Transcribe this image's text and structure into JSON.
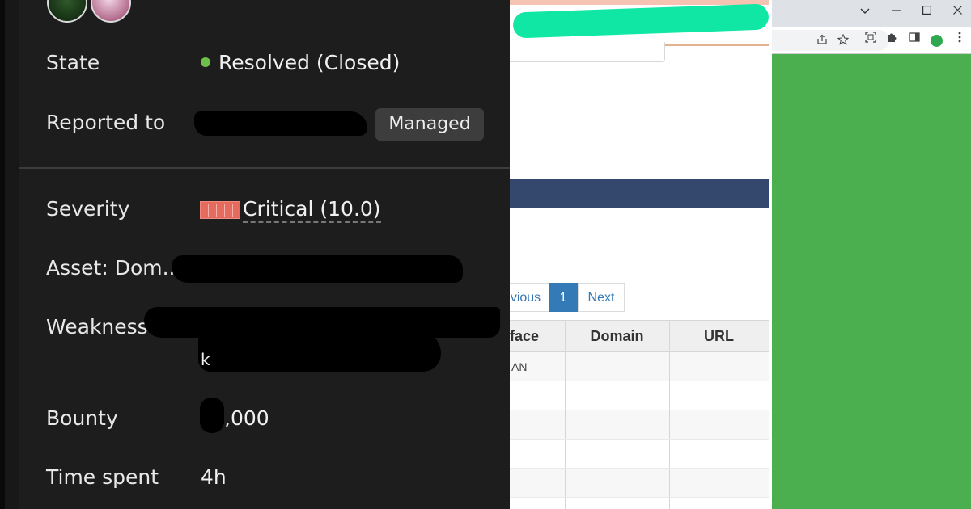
{
  "report": {
    "state_label": "State",
    "state_value": "Resolved (Closed)",
    "state_color": "#6ec04a",
    "reported_to_label": "Reported to",
    "reported_to_badge": "Managed",
    "severity_label": "Severity",
    "severity_value": "Critical (10.0)",
    "severity_color": "#e56b5f",
    "asset_label": "Asset: Dom...",
    "weakness_label": "Weakness",
    "weakness_visible_char": "k",
    "bounty_label": "Bounty",
    "bounty_value": ",000",
    "time_spent_label": "Time spent",
    "time_spent_value": "4h"
  },
  "table_view": {
    "pagination": {
      "previous_label": "vious",
      "current_page": "1",
      "next_label": "Next"
    },
    "columns": [
      "face",
      "Domain",
      "URL"
    ],
    "rows": [
      [
        "AN",
        "",
        ""
      ],
      [
        "",
        "",
        ""
      ],
      [
        "",
        "",
        ""
      ],
      [
        "",
        "",
        ""
      ],
      [
        "",
        "",
        ""
      ],
      [
        "",
        "",
        ""
      ]
    ],
    "header_bar_color": "#34486e",
    "active_page_color": "#337ab7"
  },
  "browser": {
    "window_buttons": [
      "chevron-down-icon",
      "minimize-icon",
      "maximize-icon",
      "close-icon"
    ],
    "toolbar_icons": [
      "share-icon",
      "star-icon",
      "screenshot-icon",
      "puzzle-icon",
      "side-panel-icon",
      "profile-icon",
      "menu-icon"
    ],
    "content_color": "#4caf4f"
  }
}
